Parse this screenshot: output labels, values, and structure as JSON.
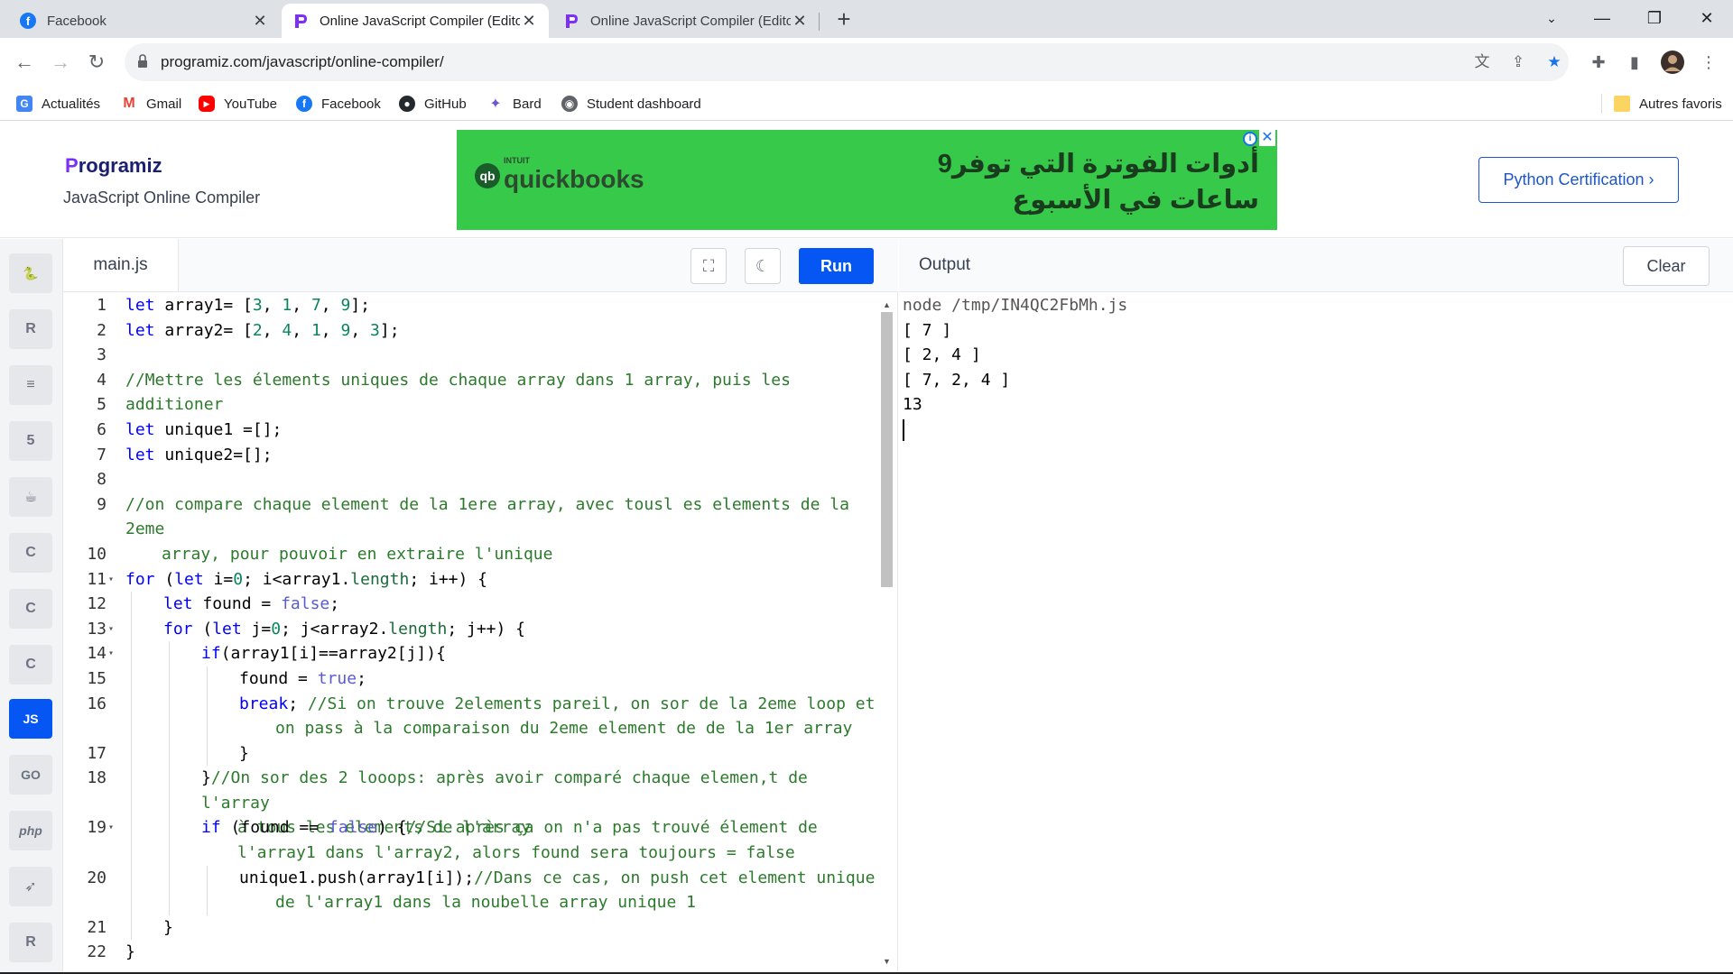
{
  "browser": {
    "tabs": [
      {
        "title": "Facebook",
        "icon": "facebook-icon",
        "active": false
      },
      {
        "title": "Online JavaScript Compiler (Edito",
        "icon": "programiz-icon",
        "active": true
      },
      {
        "title": "Online JavaScript Compiler (Edito",
        "icon": "programiz-icon",
        "active": false
      }
    ],
    "url": "programiz.com/javascript/online-compiler/",
    "bookmarks": [
      {
        "label": "Actualités",
        "icon": "google-news-icon",
        "color": "#4285f4"
      },
      {
        "label": "Gmail",
        "icon": "gmail-icon",
        "color": "#ea4335"
      },
      {
        "label": "YouTube",
        "icon": "youtube-icon",
        "color": "#ff0000"
      },
      {
        "label": "Facebook",
        "icon": "facebook-icon",
        "color": "#1877f2"
      },
      {
        "label": "GitHub",
        "icon": "github-icon",
        "color": "#24292e"
      },
      {
        "label": "Bard",
        "icon": "bard-icon",
        "color": "#6a5acd"
      },
      {
        "label": "Student dashboard",
        "icon": "student-dashboard-icon",
        "color": "#5f6368"
      }
    ],
    "other_bookmarks": "Autres favoris"
  },
  "header": {
    "logo_text": "rogramiz",
    "logo_initial": "P",
    "subtitle": "JavaScript Online Compiler",
    "ad": {
      "brand_small": "INTUIT",
      "brand": "quickbooks",
      "text": "أدوات الفوترة التي توفر9 ساعات في الأسبوع"
    },
    "cert_button": "Python Certification ›"
  },
  "languages": [
    {
      "name": "python-icon",
      "glyph": "🐍",
      "active": false
    },
    {
      "name": "r-icon",
      "glyph": "R",
      "active": false
    },
    {
      "name": "sql-icon",
      "glyph": "≡",
      "active": false
    },
    {
      "name": "html5-icon",
      "glyph": "5",
      "active": false
    },
    {
      "name": "java-icon",
      "glyph": "☕",
      "active": false
    },
    {
      "name": "c-icon",
      "glyph": "C",
      "active": false
    },
    {
      "name": "cpp-icon",
      "glyph": "C",
      "active": false
    },
    {
      "name": "csharp-icon",
      "glyph": "C",
      "active": false
    },
    {
      "name": "javascript-icon",
      "glyph": "JS",
      "active": true
    },
    {
      "name": "go-icon",
      "glyph": "GO",
      "active": false
    },
    {
      "name": "php-icon",
      "glyph": "php",
      "active": false
    },
    {
      "name": "swift-icon",
      "glyph": "➶",
      "active": false
    },
    {
      "name": "rust-icon",
      "glyph": "R",
      "active": false
    }
  ],
  "editor": {
    "filename": "main.js",
    "run_label": "Run",
    "lines": [
      {
        "n": "1",
        "fold": false,
        "indent": 0,
        "html": "<span class='kw'>let</span> array1= [<span class='num'>3</span>, <span class='num'>1</span>, <span class='num'>7</span>, <span class='num'>9</span>];"
      },
      {
        "n": "2",
        "fold": false,
        "indent": 0,
        "html": "<span class='kw'>let</span> array2= [<span class='num'>2</span>, <span class='num'>4</span>, <span class='num'>1</span>, <span class='num'>9</span>, <span class='num'>3</span>];"
      },
      {
        "n": "3",
        "fold": false,
        "indent": 0,
        "html": ""
      },
      {
        "n": "4",
        "fold": false,
        "indent": 0,
        "html": "<span class='cm'>//Mettre les élements uniques de chaque array dans 1 array, puis les additioner</span>"
      },
      {
        "n": "5",
        "fold": false,
        "indent": 0,
        "html": ""
      },
      {
        "n": "6",
        "fold": false,
        "indent": 0,
        "html": "<span class='kw'>let</span> unique1 =[];"
      },
      {
        "n": "7",
        "fold": false,
        "indent": 0,
        "html": "<span class='kw'>let</span> unique2=[];"
      },
      {
        "n": "8",
        "fold": false,
        "indent": 0,
        "html": ""
      },
      {
        "n": "9",
        "fold": false,
        "indent": 0,
        "html": "<span class='cm'>//on compare chaque element de la 1ere array, avec tousl es elements de la 2eme</span>",
        "cont": "<span class='cm'>array, pour pouvoir en extraire l'unique</span>"
      },
      {
        "n": "10",
        "fold": false,
        "indent": 0,
        "html": ""
      },
      {
        "n": "11",
        "fold": true,
        "indent": 0,
        "html": "<span class='kw'>for</span> (<span class='kw'>let</span> i=<span class='num'>0</span>; i&lt;array1.<span class='prop'>length</span>; i++) {"
      },
      {
        "n": "12",
        "fold": false,
        "indent": 1,
        "html": "<span class='kw'>let</span> found = <span class='bool'>false</span>;"
      },
      {
        "n": "13",
        "fold": true,
        "indent": 1,
        "html": "<span class='kw'>for</span> (<span class='kw'>let</span> j=<span class='num'>0</span>; j&lt;array2.<span class='prop'>length</span>; j++) {"
      },
      {
        "n": "14",
        "fold": true,
        "indent": 2,
        "html": "<span class='kw'>if</span>(array1[i]==array2[j]){"
      },
      {
        "n": "15",
        "fold": false,
        "indent": 3,
        "html": "found = <span class='bool'>true</span>;"
      },
      {
        "n": "16",
        "fold": false,
        "indent": 3,
        "html": "<span class='kw'>break</span>; <span class='cm'>//Si on trouve 2elements pareil, on sor de la 2eme loop et</span>",
        "cont": "<span class='cm'>on pass à la comparaison du 2eme element de de la 1er array</span>"
      },
      {
        "n": "17",
        "fold": false,
        "indent": 3,
        "html": "}"
      },
      {
        "n": "18",
        "fold": false,
        "indent": 2,
        "html": "}<span class='cm'>//On sor des 2 looops: après avoir comparé chaque elemen,t de l'array</span>",
        "cont": "<span class='cm'>à tous les elements de l'array</span>"
      },
      {
        "n": "19",
        "fold": true,
        "indent": 2,
        "html": "<span class='kw'>if</span> (found == <span class='bool'>false</span>) {<span class='cm'>//Si après ça on n'a pas trouvé élement de</span>",
        "cont": "<span class='cm'>l'array1 dans l'array2, alors found sera toujours = false</span>"
      },
      {
        "n": "20",
        "fold": false,
        "indent": 3,
        "html": "unique1.push(array1[i]);<span class='cm'>//Dans ce cas, on push cet element unique</span>",
        "cont": "<span class='cm'>de l'array1 dans la noubelle array unique 1</span>"
      },
      {
        "n": "21",
        "fold": false,
        "indent": 1,
        "html": "}"
      },
      {
        "n": "22",
        "fold": false,
        "indent": 0,
        "html": "}"
      }
    ]
  },
  "output": {
    "label": "Output",
    "clear_label": "Clear",
    "command": "node /tmp/IN4QC2FbMh.js",
    "lines": [
      "[ 7 ]",
      "[ 2, 4 ]",
      "[ 7, 2, 4 ]",
      "13"
    ]
  }
}
